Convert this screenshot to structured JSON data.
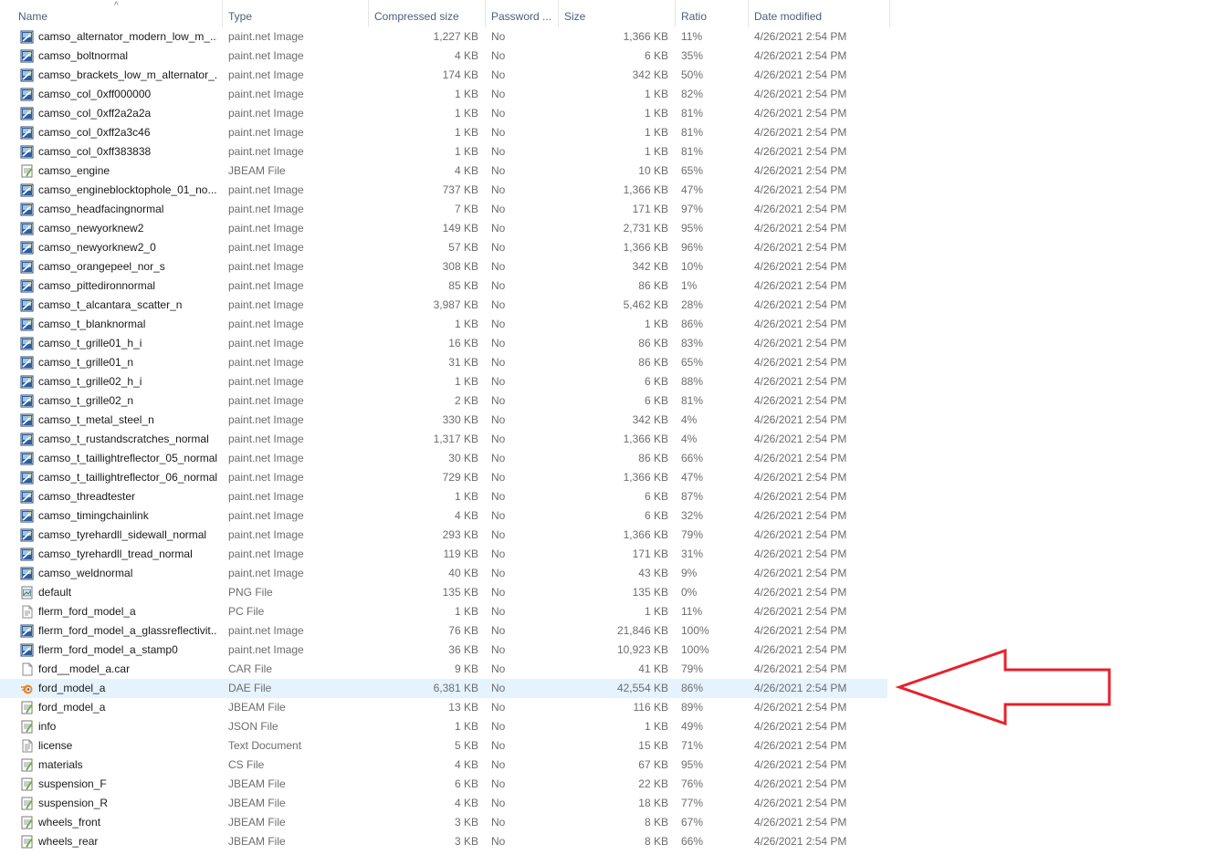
{
  "columns": {
    "name": "Name",
    "type": "Type",
    "compressed": "Compressed size",
    "password": "Password ...",
    "size": "Size",
    "ratio": "Ratio",
    "date": "Date modified"
  },
  "selected_index": 34,
  "accent_colors": {
    "selection": "#e5f3ff",
    "arrow": "#e8202a"
  },
  "rows": [
    {
      "name": "camso_alternator_modern_low_m_...",
      "type": "paint.net Image",
      "compressed": "1,227 KB",
      "password": "No",
      "size": "1,366 KB",
      "ratio": "11%",
      "date": "4/26/2021 2:54 PM",
      "icon": "paintnet-image-icon"
    },
    {
      "name": "camso_boltnormal",
      "type": "paint.net Image",
      "compressed": "4 KB",
      "password": "No",
      "size": "6 KB",
      "ratio": "35%",
      "date": "4/26/2021 2:54 PM",
      "icon": "paintnet-image-icon"
    },
    {
      "name": "camso_brackets_low_m_alternator_...",
      "type": "paint.net Image",
      "compressed": "174 KB",
      "password": "No",
      "size": "342 KB",
      "ratio": "50%",
      "date": "4/26/2021 2:54 PM",
      "icon": "paintnet-image-icon"
    },
    {
      "name": "camso_col_0xff000000",
      "type": "paint.net Image",
      "compressed": "1 KB",
      "password": "No",
      "size": "1 KB",
      "ratio": "82%",
      "date": "4/26/2021 2:54 PM",
      "icon": "paintnet-image-icon"
    },
    {
      "name": "camso_col_0xff2a2a2a",
      "type": "paint.net Image",
      "compressed": "1 KB",
      "password": "No",
      "size": "1 KB",
      "ratio": "81%",
      "date": "4/26/2021 2:54 PM",
      "icon": "paintnet-image-icon"
    },
    {
      "name": "camso_col_0xff2a3c46",
      "type": "paint.net Image",
      "compressed": "1 KB",
      "password": "No",
      "size": "1 KB",
      "ratio": "81%",
      "date": "4/26/2021 2:54 PM",
      "icon": "paintnet-image-icon"
    },
    {
      "name": "camso_col_0xff383838",
      "type": "paint.net Image",
      "compressed": "1 KB",
      "password": "No",
      "size": "1 KB",
      "ratio": "81%",
      "date": "4/26/2021 2:54 PM",
      "icon": "paintnet-image-icon"
    },
    {
      "name": "camso_engine",
      "type": "JBEAM File",
      "compressed": "4 KB",
      "password": "No",
      "size": "10 KB",
      "ratio": "65%",
      "date": "4/26/2021 2:54 PM",
      "icon": "jbeam-file-icon"
    },
    {
      "name": "camso_engineblocktophole_01_no...",
      "type": "paint.net Image",
      "compressed": "737 KB",
      "password": "No",
      "size": "1,366 KB",
      "ratio": "47%",
      "date": "4/26/2021 2:54 PM",
      "icon": "paintnet-image-icon"
    },
    {
      "name": "camso_headfacingnormal",
      "type": "paint.net Image",
      "compressed": "7 KB",
      "password": "No",
      "size": "171 KB",
      "ratio": "97%",
      "date": "4/26/2021 2:54 PM",
      "icon": "paintnet-image-icon"
    },
    {
      "name": "camso_newyorknew2",
      "type": "paint.net Image",
      "compressed": "149 KB",
      "password": "No",
      "size": "2,731 KB",
      "ratio": "95%",
      "date": "4/26/2021 2:54 PM",
      "icon": "paintnet-image-icon"
    },
    {
      "name": "camso_newyorknew2_0",
      "type": "paint.net Image",
      "compressed": "57 KB",
      "password": "No",
      "size": "1,366 KB",
      "ratio": "96%",
      "date": "4/26/2021 2:54 PM",
      "icon": "paintnet-image-icon"
    },
    {
      "name": "camso_orangepeel_nor_s",
      "type": "paint.net Image",
      "compressed": "308 KB",
      "password": "No",
      "size": "342 KB",
      "ratio": "10%",
      "date": "4/26/2021 2:54 PM",
      "icon": "paintnet-image-icon"
    },
    {
      "name": "camso_pittedironnormal",
      "type": "paint.net Image",
      "compressed": "85 KB",
      "password": "No",
      "size": "86 KB",
      "ratio": "1%",
      "date": "4/26/2021 2:54 PM",
      "icon": "paintnet-image-icon"
    },
    {
      "name": "camso_t_alcantara_scatter_n",
      "type": "paint.net Image",
      "compressed": "3,987 KB",
      "password": "No",
      "size": "5,462 KB",
      "ratio": "28%",
      "date": "4/26/2021 2:54 PM",
      "icon": "paintnet-image-icon"
    },
    {
      "name": "camso_t_blanknormal",
      "type": "paint.net Image",
      "compressed": "1 KB",
      "password": "No",
      "size": "1 KB",
      "ratio": "86%",
      "date": "4/26/2021 2:54 PM",
      "icon": "paintnet-image-icon"
    },
    {
      "name": "camso_t_grille01_h_i",
      "type": "paint.net Image",
      "compressed": "16 KB",
      "password": "No",
      "size": "86 KB",
      "ratio": "83%",
      "date": "4/26/2021 2:54 PM",
      "icon": "paintnet-image-icon"
    },
    {
      "name": "camso_t_grille01_n",
      "type": "paint.net Image",
      "compressed": "31 KB",
      "password": "No",
      "size": "86 KB",
      "ratio": "65%",
      "date": "4/26/2021 2:54 PM",
      "icon": "paintnet-image-icon"
    },
    {
      "name": "camso_t_grille02_h_i",
      "type": "paint.net Image",
      "compressed": "1 KB",
      "password": "No",
      "size": "6 KB",
      "ratio": "88%",
      "date": "4/26/2021 2:54 PM",
      "icon": "paintnet-image-icon"
    },
    {
      "name": "camso_t_grille02_n",
      "type": "paint.net Image",
      "compressed": "2 KB",
      "password": "No",
      "size": "6 KB",
      "ratio": "81%",
      "date": "4/26/2021 2:54 PM",
      "icon": "paintnet-image-icon"
    },
    {
      "name": "camso_t_metal_steel_n",
      "type": "paint.net Image",
      "compressed": "330 KB",
      "password": "No",
      "size": "342 KB",
      "ratio": "4%",
      "date": "4/26/2021 2:54 PM",
      "icon": "paintnet-image-icon"
    },
    {
      "name": "camso_t_rustandscratches_normal",
      "type": "paint.net Image",
      "compressed": "1,317 KB",
      "password": "No",
      "size": "1,366 KB",
      "ratio": "4%",
      "date": "4/26/2021 2:54 PM",
      "icon": "paintnet-image-icon"
    },
    {
      "name": "camso_t_taillightreflector_05_normal",
      "type": "paint.net Image",
      "compressed": "30 KB",
      "password": "No",
      "size": "86 KB",
      "ratio": "66%",
      "date": "4/26/2021 2:54 PM",
      "icon": "paintnet-image-icon"
    },
    {
      "name": "camso_t_taillightreflector_06_normal",
      "type": "paint.net Image",
      "compressed": "729 KB",
      "password": "No",
      "size": "1,366 KB",
      "ratio": "47%",
      "date": "4/26/2021 2:54 PM",
      "icon": "paintnet-image-icon"
    },
    {
      "name": "camso_threadtester",
      "type": "paint.net Image",
      "compressed": "1 KB",
      "password": "No",
      "size": "6 KB",
      "ratio": "87%",
      "date": "4/26/2021 2:54 PM",
      "icon": "paintnet-image-icon"
    },
    {
      "name": "camso_timingchainlink",
      "type": "paint.net Image",
      "compressed": "4 KB",
      "password": "No",
      "size": "6 KB",
      "ratio": "32%",
      "date": "4/26/2021 2:54 PM",
      "icon": "paintnet-image-icon"
    },
    {
      "name": "camso_tyrehardll_sidewall_normal",
      "type": "paint.net Image",
      "compressed": "293 KB",
      "password": "No",
      "size": "1,366 KB",
      "ratio": "79%",
      "date": "4/26/2021 2:54 PM",
      "icon": "paintnet-image-icon"
    },
    {
      "name": "camso_tyrehardll_tread_normal",
      "type": "paint.net Image",
      "compressed": "119 KB",
      "password": "No",
      "size": "171 KB",
      "ratio": "31%",
      "date": "4/26/2021 2:54 PM",
      "icon": "paintnet-image-icon"
    },
    {
      "name": "camso_weldnormal",
      "type": "paint.net Image",
      "compressed": "40 KB",
      "password": "No",
      "size": "43 KB",
      "ratio": "9%",
      "date": "4/26/2021 2:54 PM",
      "icon": "paintnet-image-icon"
    },
    {
      "name": "default",
      "type": "PNG File",
      "compressed": "135 KB",
      "password": "No",
      "size": "135 KB",
      "ratio": "0%",
      "date": "4/26/2021 2:54 PM",
      "icon": "png-file-icon"
    },
    {
      "name": "flerm_ford_model_a",
      "type": "PC File",
      "compressed": "1 KB",
      "password": "No",
      "size": "1 KB",
      "ratio": "11%",
      "date": "4/26/2021 2:54 PM",
      "icon": "pc-file-icon"
    },
    {
      "name": "flerm_ford_model_a_glassreflectivit...",
      "type": "paint.net Image",
      "compressed": "76 KB",
      "password": "No",
      "size": "21,846 KB",
      "ratio": "100%",
      "date": "4/26/2021 2:54 PM",
      "icon": "paintnet-image-icon"
    },
    {
      "name": "flerm_ford_model_a_stamp0",
      "type": "paint.net Image",
      "compressed": "36 KB",
      "password": "No",
      "size": "10,923 KB",
      "ratio": "100%",
      "date": "4/26/2021 2:54 PM",
      "icon": "paintnet-image-icon"
    },
    {
      "name": "ford__model_a.car",
      "type": "CAR File",
      "compressed": "9 KB",
      "password": "No",
      "size": "41 KB",
      "ratio": "79%",
      "date": "4/26/2021 2:54 PM",
      "icon": "blank-file-icon"
    },
    {
      "name": "ford_model_a",
      "type": "DAE File",
      "compressed": "6,381 KB",
      "password": "No",
      "size": "42,554 KB",
      "ratio": "86%",
      "date": "4/26/2021 2:54 PM",
      "icon": "blender-file-icon"
    },
    {
      "name": "ford_model_a",
      "type": "JBEAM File",
      "compressed": "13 KB",
      "password": "No",
      "size": "116 KB",
      "ratio": "89%",
      "date": "4/26/2021 2:54 PM",
      "icon": "jbeam-file-icon"
    },
    {
      "name": "info",
      "type": "JSON File",
      "compressed": "1 KB",
      "password": "No",
      "size": "1 KB",
      "ratio": "49%",
      "date": "4/26/2021 2:54 PM",
      "icon": "json-file-icon"
    },
    {
      "name": "license",
      "type": "Text Document",
      "compressed": "5 KB",
      "password": "No",
      "size": "15 KB",
      "ratio": "71%",
      "date": "4/26/2021 2:54 PM",
      "icon": "text-file-icon"
    },
    {
      "name": "materials",
      "type": "CS File",
      "compressed": "4 KB",
      "password": "No",
      "size": "67 KB",
      "ratio": "95%",
      "date": "4/26/2021 2:54 PM",
      "icon": "cs-file-icon"
    },
    {
      "name": "suspension_F",
      "type": "JBEAM File",
      "compressed": "6 KB",
      "password": "No",
      "size": "22 KB",
      "ratio": "76%",
      "date": "4/26/2021 2:54 PM",
      "icon": "jbeam-file-icon"
    },
    {
      "name": "suspension_R",
      "type": "JBEAM File",
      "compressed": "4 KB",
      "password": "No",
      "size": "18 KB",
      "ratio": "77%",
      "date": "4/26/2021 2:54 PM",
      "icon": "jbeam-file-icon"
    },
    {
      "name": "wheels_front",
      "type": "JBEAM File",
      "compressed": "3 KB",
      "password": "No",
      "size": "8 KB",
      "ratio": "67%",
      "date": "4/26/2021 2:54 PM",
      "icon": "jbeam-file-icon"
    },
    {
      "name": "wheels_rear",
      "type": "JBEAM File",
      "compressed": "3 KB",
      "password": "No",
      "size": "8 KB",
      "ratio": "66%",
      "date": "4/26/2021 2:54 PM",
      "icon": "jbeam-file-icon"
    }
  ]
}
